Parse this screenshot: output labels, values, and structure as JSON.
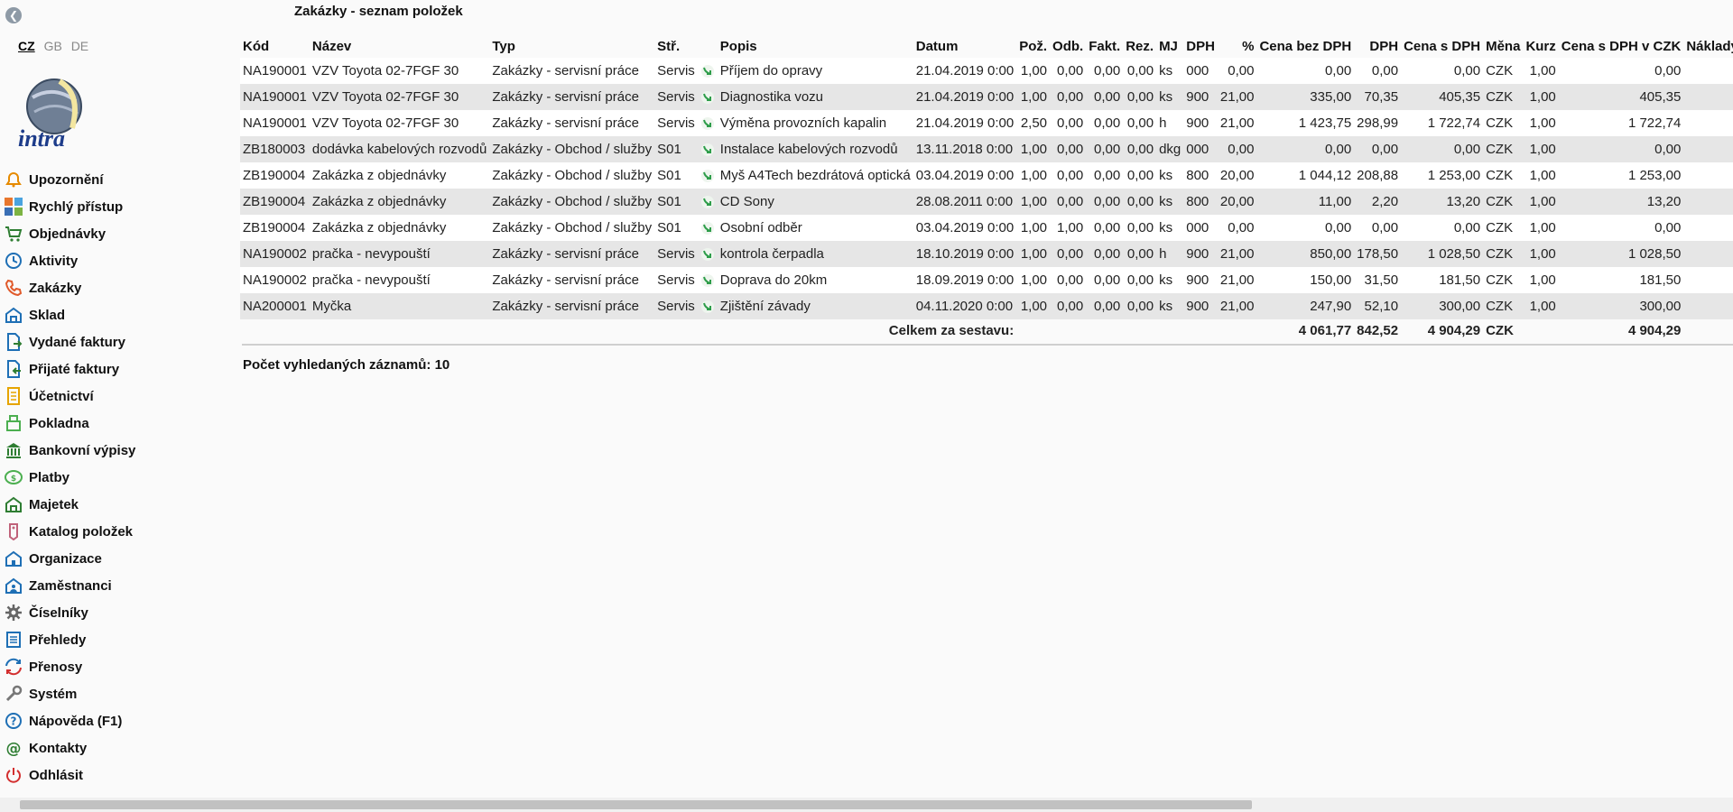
{
  "page": {
    "title": "Zakázky - seznam položek"
  },
  "languages": [
    "CZ",
    "GB",
    "DE"
  ],
  "logo_text": "intra",
  "menu": [
    {
      "label": "Upozornění",
      "icon": "bell-icon"
    },
    {
      "label": "Rychlý přístup",
      "icon": "tiles-icon"
    },
    {
      "label": "Objednávky",
      "icon": "cart-icon"
    },
    {
      "label": "Aktivity",
      "icon": "clock-icon"
    },
    {
      "label": "Zakázky",
      "icon": "phone-icon"
    },
    {
      "label": "Sklad",
      "icon": "warehouse-icon"
    },
    {
      "label": "Vydané faktury",
      "icon": "invoice-out-icon"
    },
    {
      "label": "Přijaté faktury",
      "icon": "invoice-in-icon"
    },
    {
      "label": "Účetnictví",
      "icon": "ledger-icon"
    },
    {
      "label": "Pokladna",
      "icon": "cashbox-icon"
    },
    {
      "label": "Bankovní výpisy",
      "icon": "bank-icon"
    },
    {
      "label": "Platby",
      "icon": "payment-icon"
    },
    {
      "label": "Majetek",
      "icon": "property-icon"
    },
    {
      "label": "Katalog položek",
      "icon": "tag-icon"
    },
    {
      "label": "Organizace",
      "icon": "organization-icon"
    },
    {
      "label": "Zaměstnanci",
      "icon": "employees-icon"
    },
    {
      "label": "Číselníky",
      "icon": "gear-icon"
    },
    {
      "label": "Přehledy",
      "icon": "list-icon"
    },
    {
      "label": "Přenosy",
      "icon": "sync-icon"
    },
    {
      "label": "Systém",
      "icon": "wrench-icon"
    },
    {
      "label": "Nápověda (F1)",
      "icon": "help-icon"
    },
    {
      "label": "Kontakty",
      "icon": "at-icon"
    },
    {
      "label": "Odhlásit",
      "icon": "power-icon"
    }
  ],
  "table": {
    "columns": [
      "Kód",
      "Název",
      "Typ",
      "Stř.",
      "",
      "Popis",
      "Datum",
      "Pož.",
      "Odb.",
      "Fakt.",
      "Rez.",
      "MJ",
      "DPH",
      "%",
      "Cena bez DPH",
      "DPH",
      "Cena s DPH",
      "Měna",
      "Kurz",
      "Cena s DPH v CZK",
      "Náklady"
    ],
    "rows": [
      [
        "NA190001",
        "VZV Toyota 02-7FGF 30",
        "Zakázky - servisní práce",
        "Servis",
        "",
        "Příjem do opravy",
        "21.04.2019 0:00",
        "1,00",
        "0,00",
        "0,00",
        "0,00",
        "ks",
        "000",
        "0,00",
        "0,00",
        "0,00",
        "0,00",
        "CZK",
        "1,00",
        "0,00",
        ""
      ],
      [
        "NA190001",
        "VZV Toyota 02-7FGF 30",
        "Zakázky - servisní práce",
        "Servis",
        "",
        "Diagnostika vozu",
        "21.04.2019 0:00",
        "1,00",
        "0,00",
        "0,00",
        "0,00",
        "ks",
        "900",
        "21,00",
        "335,00",
        "70,35",
        "405,35",
        "CZK",
        "1,00",
        "405,35",
        ""
      ],
      [
        "NA190001",
        "VZV Toyota 02-7FGF 30",
        "Zakázky - servisní práce",
        "Servis",
        "",
        "Výměna provozních kapalin",
        "21.04.2019 0:00",
        "2,50",
        "0,00",
        "0,00",
        "0,00",
        "h",
        "900",
        "21,00",
        "1 423,75",
        "298,99",
        "1 722,74",
        "CZK",
        "1,00",
        "1 722,74",
        ""
      ],
      [
        "ZB180003",
        "dodávka kabelových rozvodů",
        "Zakázky - Obchod / služby",
        "S01",
        "",
        "Instalace kabelových rozvodů",
        "13.11.2018 0:00",
        "1,00",
        "0,00",
        "0,00",
        "0,00",
        "dkg",
        "000",
        "0,00",
        "0,00",
        "0,00",
        "0,00",
        "CZK",
        "1,00",
        "0,00",
        ""
      ],
      [
        "ZB190004",
        "Zakázka z objednávky",
        "Zakázky - Obchod / služby",
        "S01",
        "",
        "Myš A4Tech bezdrátová optická",
        "03.04.2019 0:00",
        "1,00",
        "0,00",
        "0,00",
        "0,00",
        "ks",
        "800",
        "20,00",
        "1 044,12",
        "208,88",
        "1 253,00",
        "CZK",
        "1,00",
        "1 253,00",
        ""
      ],
      [
        "ZB190004",
        "Zakázka z objednávky",
        "Zakázky - Obchod / služby",
        "S01",
        "",
        "CD Sony",
        "28.08.2011 0:00",
        "1,00",
        "0,00",
        "0,00",
        "0,00",
        "ks",
        "800",
        "20,00",
        "11,00",
        "2,20",
        "13,20",
        "CZK",
        "1,00",
        "13,20",
        ""
      ],
      [
        "ZB190004",
        "Zakázka z objednávky",
        "Zakázky - Obchod / služby",
        "S01",
        "",
        "Osobní odběr",
        "03.04.2019 0:00",
        "1,00",
        "1,00",
        "0,00",
        "0,00",
        "ks",
        "000",
        "0,00",
        "0,00",
        "0,00",
        "0,00",
        "CZK",
        "1,00",
        "0,00",
        ""
      ],
      [
        "NA190002",
        "pračka - nevypouští",
        "Zakázky - servisní práce",
        "Servis",
        "",
        "kontrola čerpadla",
        "18.10.2019 0:00",
        "1,00",
        "0,00",
        "0,00",
        "0,00",
        "h",
        "900",
        "21,00",
        "850,00",
        "178,50",
        "1 028,50",
        "CZK",
        "1,00",
        "1 028,50",
        ""
      ],
      [
        "NA190002",
        "pračka - nevypouští",
        "Zakázky - servisní práce",
        "Servis",
        "",
        "Doprava do 20km",
        "18.09.2019 0:00",
        "1,00",
        "0,00",
        "0,00",
        "0,00",
        "ks",
        "900",
        "21,00",
        "150,00",
        "31,50",
        "181,50",
        "CZK",
        "1,00",
        "181,50",
        ""
      ],
      [
        "NA200001",
        "Myčka",
        "Zakázky - servisní práce",
        "Servis",
        "",
        "Zjištění závady",
        "04.11.2020 0:00",
        "1,00",
        "0,00",
        "0,00",
        "0,00",
        "ks",
        "900",
        "21,00",
        "247,90",
        "52,10",
        "300,00",
        "CZK",
        "1,00",
        "300,00",
        ""
      ]
    ],
    "totals": {
      "label": "Celkem za sestavu:",
      "cena_bez_dph": "4 061,77",
      "dph": "842,52",
      "cena_s_dph": "4 904,29",
      "mena": "CZK",
      "cena_czk": "4 904,29"
    }
  },
  "footer": {
    "count_text": "Počet vyhledaných záznamů: 10"
  },
  "colors": {
    "accent": "#2e7d32",
    "row_alt": "#e6e6e6"
  }
}
